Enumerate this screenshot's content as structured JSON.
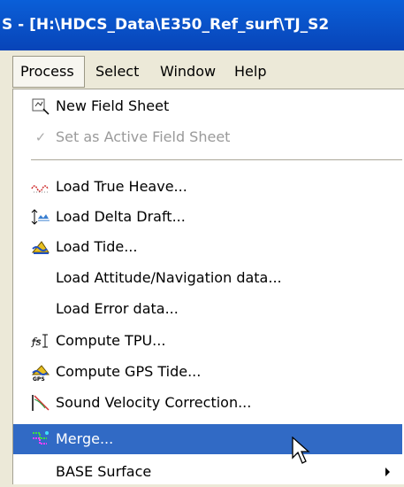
{
  "window": {
    "title": "S - [H:\\HDCS_Data\\E350_Ref_surf\\TJ_S2"
  },
  "menubar": {
    "items": [
      "Process",
      "Select",
      "Window",
      "Help"
    ]
  },
  "process_menu": {
    "items": [
      {
        "label": "New Field Sheet",
        "icon": "field-sheet-icon"
      },
      {
        "label": "Set as Active Field Sheet",
        "icon": "checkmark-icon",
        "enabled": false
      },
      {
        "label": "Load True Heave...",
        "icon": "heave-icon"
      },
      {
        "label": "Load Delta Draft...",
        "icon": "delta-draft-icon"
      },
      {
        "label": "Load Tide...",
        "icon": "tide-icon"
      },
      {
        "label": "Load Attitude/Navigation data...",
        "icon": ""
      },
      {
        "label": "Load Error data...",
        "icon": ""
      },
      {
        "label": "Compute TPU...",
        "icon": "tpu-icon"
      },
      {
        "label": "Compute GPS Tide...",
        "icon": "gps-tide-icon"
      },
      {
        "label": "Sound Velocity Correction...",
        "icon": "sound-velocity-icon"
      },
      {
        "label": "Merge...",
        "icon": "merge-icon",
        "selected": true
      },
      {
        "label": "BASE Surface",
        "icon": "",
        "has_submenu": true
      }
    ]
  },
  "colors": {
    "selection": "#316ac5",
    "menu_bg": "#ece9d8",
    "title_bar": "#0a5fd8"
  }
}
